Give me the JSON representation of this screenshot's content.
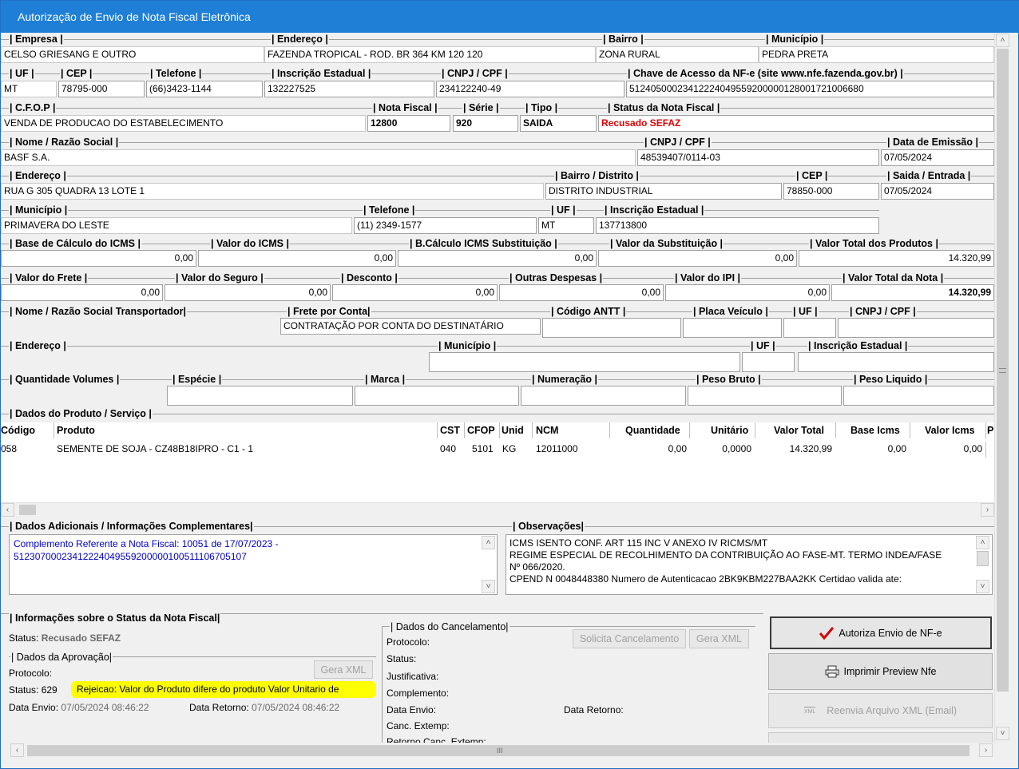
{
  "window": {
    "title": "Autorização de Envio de Nota Fiscal Eletrônica"
  },
  "emitente": {
    "empresa_label": "| Empresa |",
    "empresa": "CELSO GRIESANG E OUTRO",
    "endereco_label": "| Endereço |",
    "endereco": "FAZENDA TROPICAL - ROD. BR 364 KM 120  120",
    "bairro_label": "| Bairro |",
    "bairro": "ZONA RURAL",
    "municipio_label": "| Município |",
    "municipio": "PEDRA PRETA",
    "uf_label": "| UF |",
    "uf": "MT",
    "cep_label": "| CEP |",
    "cep": "78795-000",
    "telefone_label": "| Telefone |",
    "telefone": "(66)3423-1144",
    "ie_label": "| Inscrição Estadual |",
    "ie": "132227525",
    "cnpj_label": "| CNPJ / CPF |",
    "cnpj": "234122240-49",
    "chave_label": "| Chave de Acesso da NF-e (site www.nfe.fazenda.gov.br) |",
    "chave": "51240500023412224049559200000128001721006680",
    "cfop_label": "| C.F.O.P |",
    "cfop": "VENDA DE PRODUCAO DO ESTABELECIMENTO",
    "nf_label": "| Nota Fiscal |",
    "nf": "12800",
    "serie_label": "| Série |",
    "serie": "920",
    "tipo_label": "| Tipo |",
    "tipo": "SAIDA",
    "status_label": "| Status da Nota Fiscal |",
    "status": "Recusado SEFAZ"
  },
  "destinatario": {
    "nome_label": "| Nome  / Razão Social |",
    "nome": "BASF S.A.",
    "cnpj_label": "| CNPJ / CPF |",
    "cnpj": "48539407/0114-03",
    "emissao_label": "| Data de Emissão |",
    "emissao": "07/05/2024",
    "endereco_label": "| Endereço |",
    "endereco": "RUA G  305  QUADRA 13 LOTE 1",
    "bairro_label": "| Bairro / Distrito |",
    "bairro": "DISTRITO INDUSTRIAL",
    "cep_label": "| CEP |",
    "cep": "78850-000",
    "saida_label": "| Saida / Entrada |",
    "saida": "07/05/2024",
    "municipio_label": "| Município |",
    "municipio": "PRIMAVERA DO LESTE",
    "telefone_label": "| Telefone |",
    "telefone": "(11) 2349-1577",
    "uf_label": "| UF |",
    "uf": "MT",
    "ie_label": "| Inscrição Estadual |",
    "ie": "137713800"
  },
  "totais": {
    "bc_icms_label": "| Base de Cálculo do ICMS |",
    "bc_icms": "0,00",
    "v_icms_label": "| Valor do ICMS |",
    "v_icms": "0,00",
    "bc_st_label": "| B.Cálculo ICMS Substituição |",
    "bc_st": "0,00",
    "v_st_label": "| Valor da Substituição |",
    "v_st": "0,00",
    "v_prod_label": "| Valor Total dos Produtos |",
    "v_prod": "14.320,99",
    "frete_label": "| Valor do Frete |",
    "frete": "0,00",
    "seguro_label": "| Valor do Seguro |",
    "seguro": "0,00",
    "desconto_label": "| Desconto |",
    "desconto": "0,00",
    "outras_label": "| Outras Despesas |",
    "outras": "0,00",
    "ipi_label": "| Valor do IPI |",
    "ipi": "0,00",
    "total_label": "| Valor Total da Nota |",
    "total": "14.320,99"
  },
  "transp": {
    "nome_label": "| Nome  / Razão Social Transportador|",
    "frete_label": "| Frete por Conta|",
    "frete": "CONTRATAÇÃO POR CONTA DO DESTINATÁRIO",
    "antt_label": "| Código ANTT |",
    "placa_label": "| Placa Veículo |",
    "uf_label": "| UF |",
    "cnpj_label": "| CNPJ / CPF |",
    "endereco_label": "| Endereço |",
    "municipio_label": "| Município |",
    "uf2_label": "| UF |",
    "ie_label": "| Inscrição Estadual |",
    "qtd_label": "| Quantidade Volumes |",
    "especie_label": "| Espécie |",
    "marca_label": "| Marca |",
    "numeracao_label": "| Numeração |",
    "pbruto_label": "| Peso Bruto |",
    "pliquido_label": "| Peso Liquido |"
  },
  "produtos": {
    "section_label": "| Dados do Produto / Serviço |",
    "headers": [
      "Código",
      "Produto",
      "CST",
      "CFOP",
      "Unid",
      "NCM",
      "Quantidade",
      "Unitário",
      "Valor Total",
      "Base Icms",
      "Valor Icms",
      "P"
    ],
    "rows": [
      [
        "058",
        "SEMENTE DE SOJA - CZ48B18IPRO - C1 - 1",
        "040",
        "5101",
        "KG",
        "12011000",
        "0,00",
        "0,0000",
        "14.320,99",
        "0,00",
        "0,00"
      ]
    ]
  },
  "adicionais": {
    "label": "| Dados Adicionais / Informações Complementares|",
    "line1": "Complemento Referente a Nota Fiscal: 10051 de 17/07/2023 -",
    "line2": "51230700023412224049559200000100511106705107"
  },
  "observacoes": {
    "label": "| Observações|",
    "line1": "ICMS ISENTO CONF.  ART 115 INC V ANEXO IV RICMS/MT",
    "line2": "REGIME ESPECIAL DE RECOLHIMENTO DA CONTRIBUIÇÃO AO FASE-MT. TERMO INDEA/FASE",
    "line3": "Nº 066/2020.",
    "line4": "CPEND N 0048448380 Numero de Autenticacao  2BK9KBM227BAA2KK Certidao valida ate:"
  },
  "status_info": {
    "label": "| Informações sobre o Status da Nota Fiscal|",
    "status_prefix": "Status:",
    "status": "Recusado SEFAZ",
    "aprov_label": "| Dados da Aprovação|",
    "protocolo": "Protocolo:",
    "gera_xml": "Gera XML",
    "status_code": "Status: 629",
    "rejeicao": "Rejeicao: Valor do Produto difere do produto Valor Unitario de",
    "envio_label": "Data Envio:",
    "envio": "07/05/2024 08:46:22",
    "retorno_label": "Data Retorno:",
    "retorno": "07/05/2024 08:46:22"
  },
  "cancelamento": {
    "label": "| Dados do Cancelamento|",
    "protocolo": "Protocolo:",
    "status": "Status:",
    "justificativa": "Justificativa:",
    "complemento": "Complemento:",
    "envio": "Data Envio:",
    "retorno": "Data Retorno:",
    "canc_extemp": "Canc. Extemp:",
    "retorno_canc": "Retorno Canc. Extemp:",
    "solicita": "Solicita Cancelamento",
    "gera_xml": "Gera XML"
  },
  "buttons": {
    "autoriza": "Autoriza Envio de NF-e",
    "imprimir": "Imprimir Preview Nfe",
    "reenvia": "Reenvia Arquivo XML (Email)",
    "xml_caption": "XML"
  },
  "colors": {
    "title_bar": "#1f7fd6",
    "status_red": "#e00000",
    "link_blue": "#0000cc",
    "highlight": "#ffff00"
  }
}
